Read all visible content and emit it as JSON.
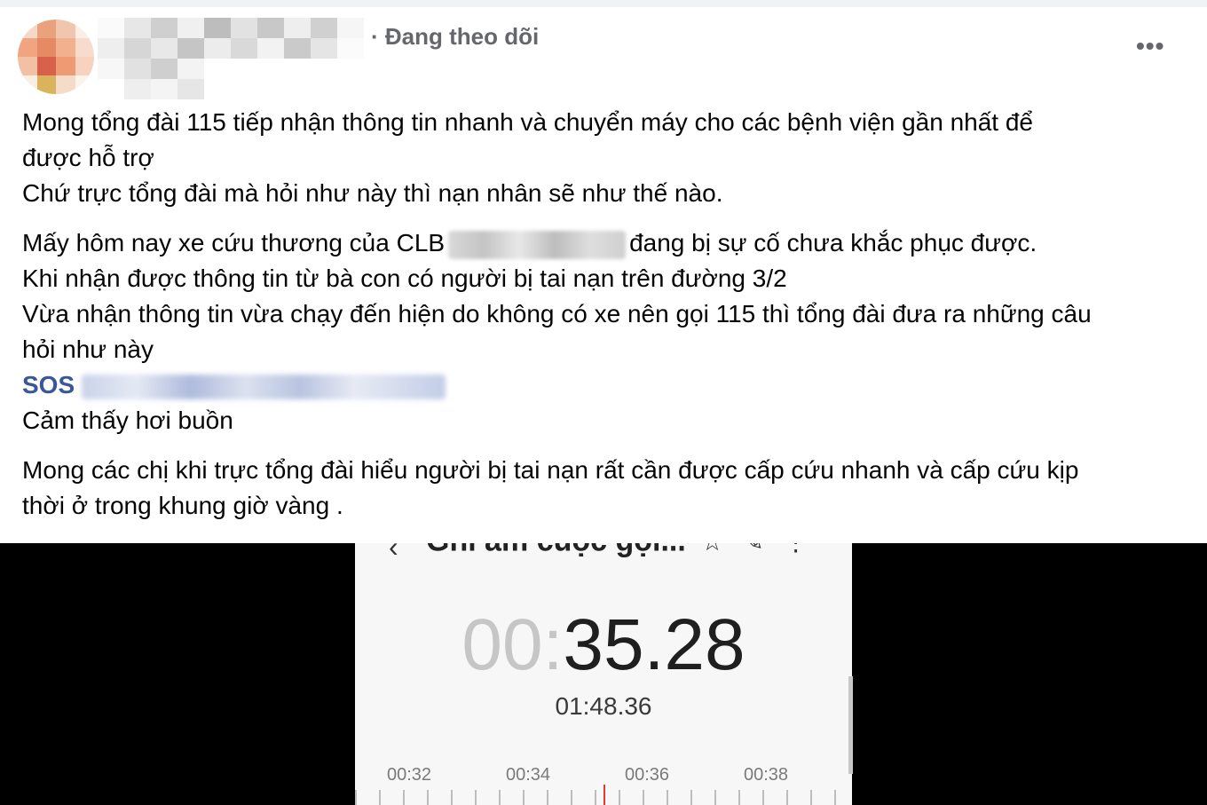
{
  "header": {
    "follow_text": "· Đang theo dõi",
    "more_label": "•••"
  },
  "post": {
    "paragraphs": [
      [
        "Mong tổng đài 115 tiếp nhận thông tin nhanh và chuyển máy cho các bệnh viện gần nhất để",
        "được hỗ trợ",
        "Chứ trực tổng đài mà hỏi như này thì nạn nhân sẽ như thế nào."
      ],
      [
        "Mấy hôm nay xe cứu thương của CLB",
        "đang bị sự cố chưa khắc phục được.",
        "Khi nhận được thông tin từ bà con có người bị tai nạn trên đường 3/2",
        "Vừa nhận thông tin vừa chạy đến hiện do không có xe nên gọi 115 thì tổng đài đưa ra những câu",
        "hỏi như này",
        "SOS",
        "Cảm thấy hơi buồn"
      ],
      [
        "Mong các chị khi trực tổng đài hiểu người bị tai nạn rất cần được cấp cứu nhanh và cấp cứu kịp",
        "thời ở trong khung giờ vàng ."
      ]
    ]
  },
  "recording": {
    "title": "Ghi âm cuộc gọi...",
    "timer_dim": "00:",
    "timer_main": "35.28",
    "total": "01:48.36",
    "ticks": [
      "00:32",
      "00:34",
      "00:36",
      "00:38"
    ]
  },
  "colors": {
    "link": "#385898",
    "meta": "#65676b"
  }
}
